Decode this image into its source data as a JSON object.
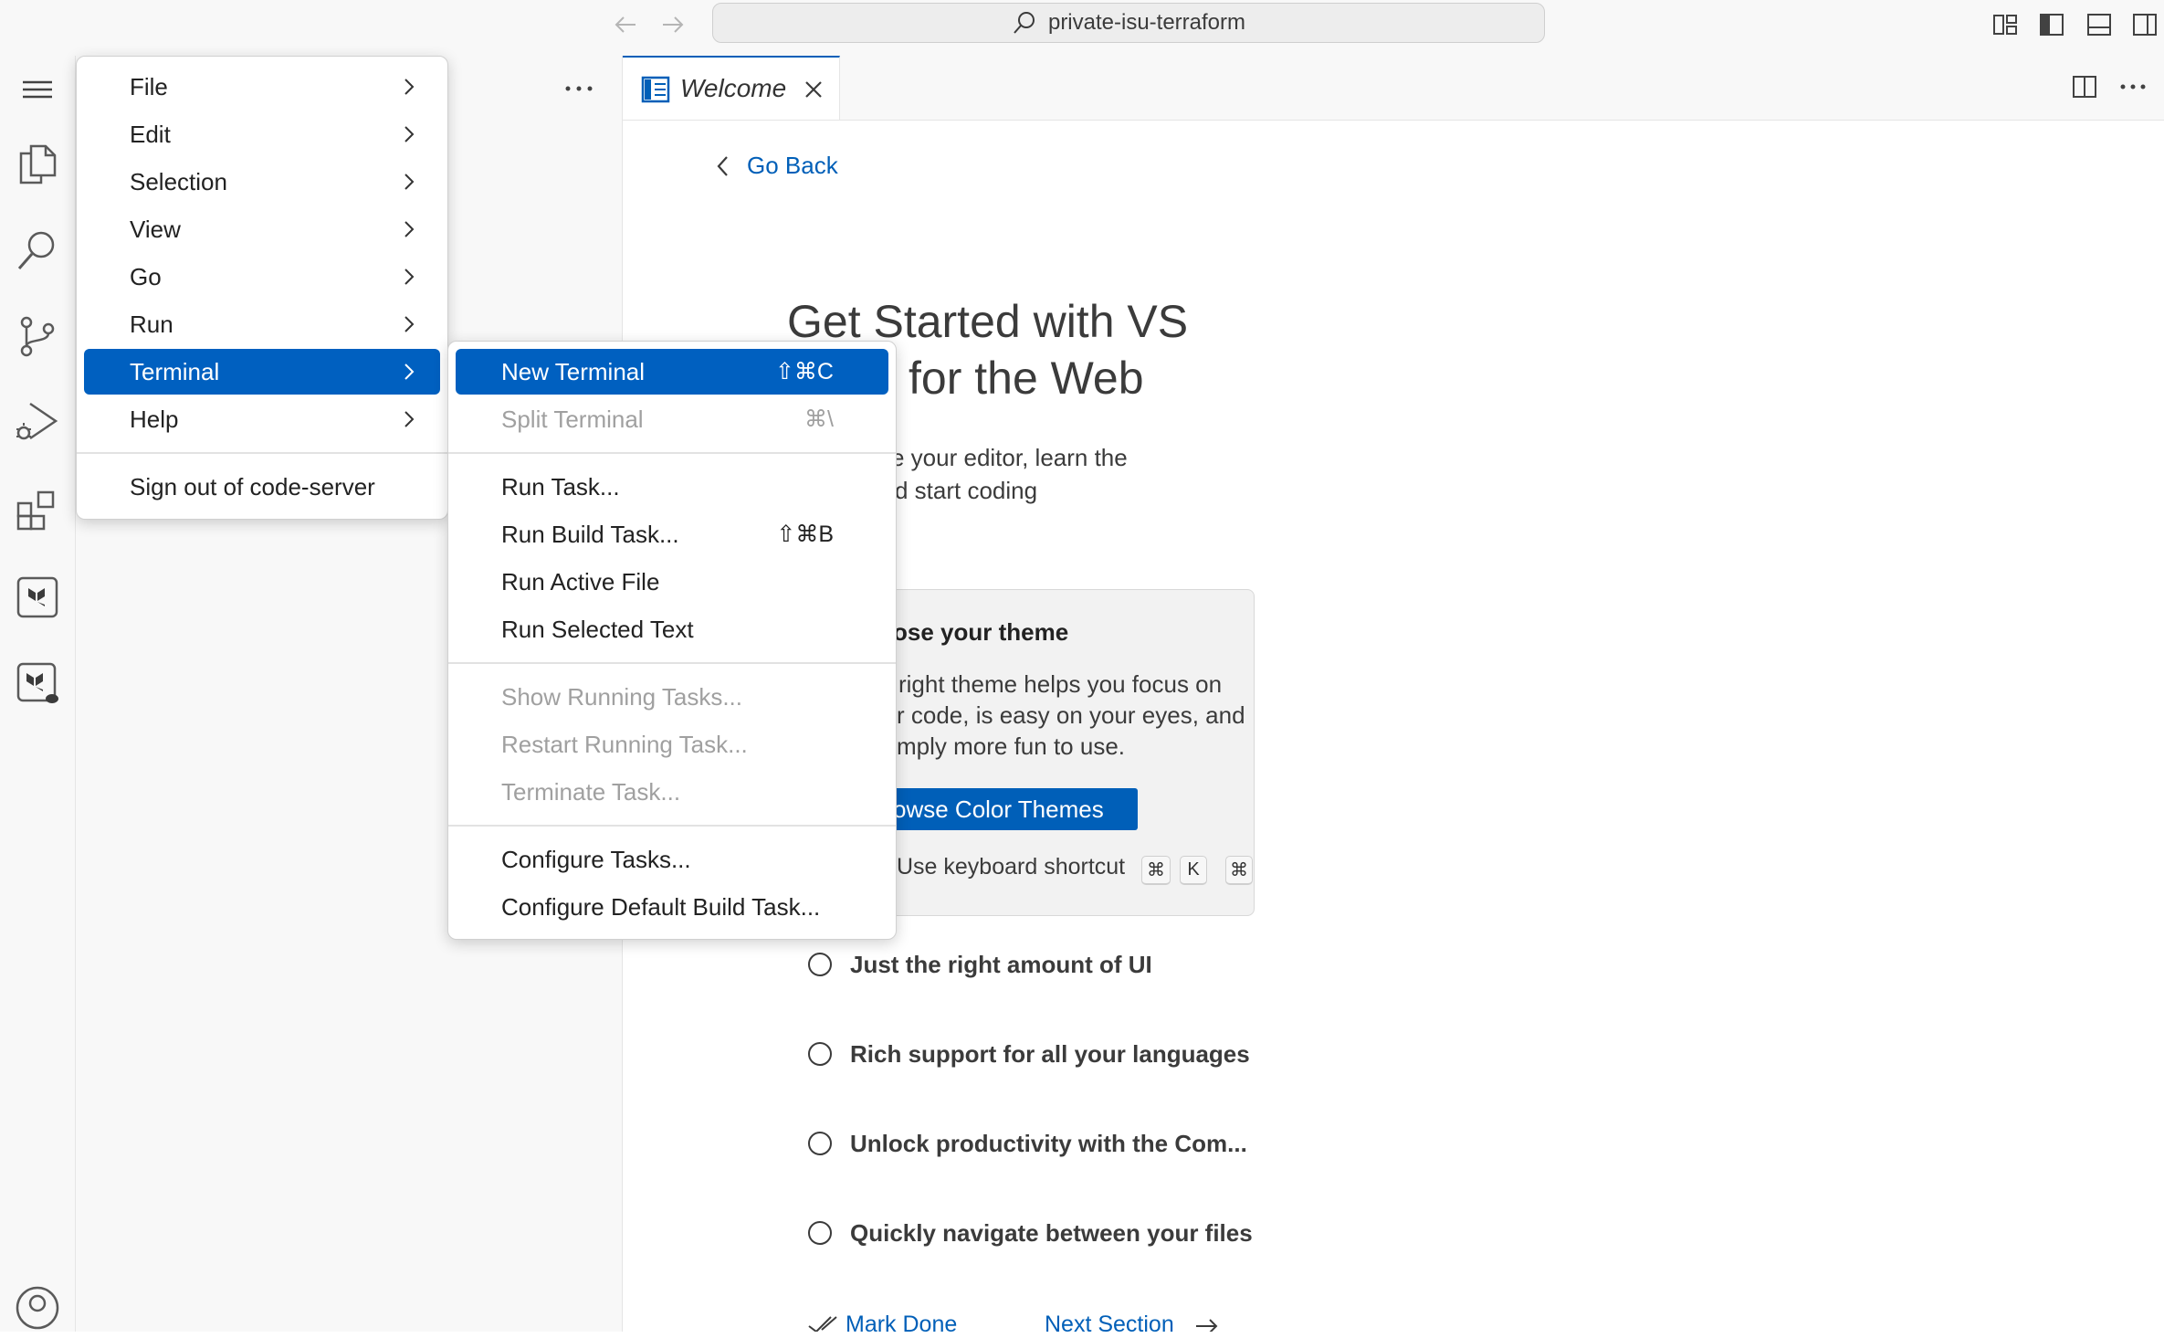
{
  "titlebar": {
    "search_text": "private-isu-terraform"
  },
  "tab": {
    "label": "Welcome"
  },
  "welcome": {
    "go_back": "Go Back",
    "title_line1": "Get Started with VS",
    "title_line2": "for the Web",
    "desc_line1": "e your editor, learn the",
    "desc_line2": "d start coding",
    "theme_title": "ose your theme",
    "theme_desc_line1": "right theme helps you focus on",
    "theme_desc_line2": "r code, is easy on your eyes, and",
    "theme_desc_line3": "mply more fun to use.",
    "theme_button": "owse Color Themes",
    "shortcut_text": "Use keyboard shortcut",
    "shortcut_keys": [
      "⌘",
      "K",
      "⌘"
    ],
    "steps": [
      "Just the right amount of UI",
      "Rich support for all your languages",
      "Unlock productivity with the Com...",
      "Quickly navigate between your files"
    ],
    "mark_done": "Mark Done",
    "next_section": "Next Section"
  },
  "main_menu": {
    "items": [
      "File",
      "Edit",
      "Selection",
      "View",
      "Go",
      "Run",
      "Terminal",
      "Help"
    ],
    "selected": "Terminal",
    "sign_out": "Sign out of code-server"
  },
  "terminal_menu": {
    "groups": [
      [
        {
          "label": "New Terminal",
          "shortcut": "⇧⌘C",
          "enabled": true,
          "selected": true
        },
        {
          "label": "Split Terminal",
          "shortcut": "⌘\\",
          "enabled": false
        }
      ],
      [
        {
          "label": "Run Task...",
          "shortcut": "",
          "enabled": true
        },
        {
          "label": "Run Build Task...",
          "shortcut": "⇧⌘B",
          "enabled": true
        },
        {
          "label": "Run Active File",
          "shortcut": "",
          "enabled": true
        },
        {
          "label": "Run Selected Text",
          "shortcut": "",
          "enabled": true
        }
      ],
      [
        {
          "label": "Show Running Tasks...",
          "shortcut": "",
          "enabled": false
        },
        {
          "label": "Restart Running Task...",
          "shortcut": "",
          "enabled": false
        },
        {
          "label": "Terminate Task...",
          "shortcut": "",
          "enabled": false
        }
      ],
      [
        {
          "label": "Configure Tasks...",
          "shortcut": "",
          "enabled": true
        },
        {
          "label": "Configure Default Build Task...",
          "shortcut": "",
          "enabled": true
        }
      ]
    ]
  },
  "colors": {
    "accent": "#005fb8",
    "menu_selection": "#0060c0",
    "sidebar_bg": "#f8f8f8"
  }
}
